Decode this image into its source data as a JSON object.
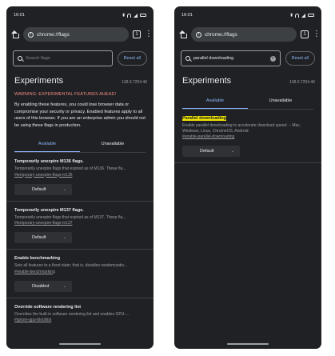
{
  "left": {
    "status": {
      "time": "16:01"
    },
    "omnibox": {
      "url": "chrome://flags",
      "tab_count": "1"
    },
    "search": {
      "placeholder": "Search flags",
      "value": "",
      "reset_label": "Reset all"
    },
    "header": {
      "title": "Experiments",
      "version": "138.0.7204.46"
    },
    "warning": "WARNING: EXPERIMENTAL FEATURES AHEAD!",
    "intro": "By enabling these features, you could lose browser data or compromise your security or privacy. Enabled features apply to all users of this browser. If you are an enterprise admin you should not be using these flags in production.",
    "tabs": [
      "Available",
      "Unavailable"
    ],
    "flags": [
      {
        "name": "Temporarily unexpire M136 flags.",
        "desc": "Temporarily unexpire flags that expired as of M136. These fla...",
        "link": "#temporary-unexpire-flags-m136",
        "value": "Default"
      },
      {
        "name": "Temporarily unexpire M137 flags.",
        "desc": "Temporarily unexpire flags that expired as of M137. These fla...",
        "link": "#temporary-unexpire-flags-m137",
        "value": "Default"
      },
      {
        "name": "Enable benchmarking",
        "desc": "Sets all features to a fixed state; that is, disables randomizatio...",
        "link": "#enable-benchmarking",
        "value": "Disabled"
      },
      {
        "name": "Override software rendering list",
        "desc": "Overrides the built-in software rendering list and enables GPU-...",
        "link": "#ignore-gpu-blocklist"
      }
    ]
  },
  "right": {
    "status": {
      "time": "16:01"
    },
    "omnibox": {
      "url": "chrome://flags",
      "tab_count": "1"
    },
    "search": {
      "placeholder": "Search flags",
      "value": "parallel downloading",
      "reset_label": "Reset all"
    },
    "header": {
      "title": "Experiments",
      "version": "138.0.7204.46"
    },
    "tabs": [
      "Available",
      "Unavailable"
    ],
    "flags": [
      {
        "name": "Parallel downloading",
        "desc": "Enable parallel downloading to accelerate download speed. – Mac, Windows, Linux, ChromeOS, Android",
        "link": "#enable-parallel-downloading",
        "value": "Default"
      }
    ]
  }
}
